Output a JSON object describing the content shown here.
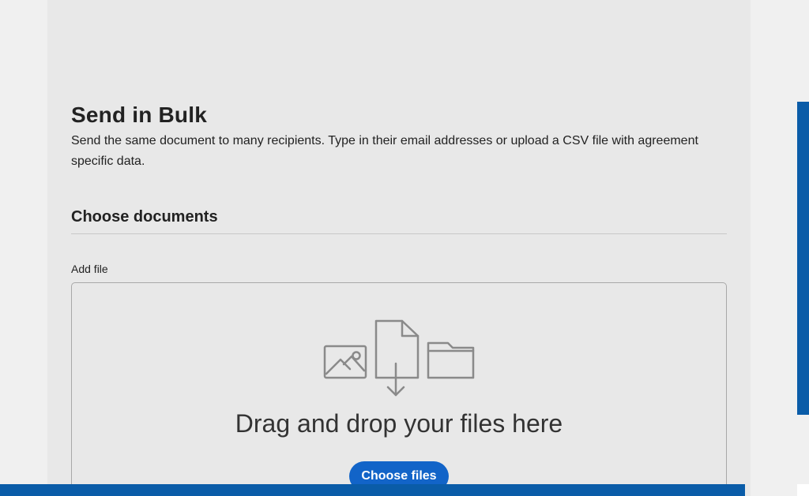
{
  "page": {
    "title": "Send in Bulk",
    "description": "Send the same document to many recipients. Type in their email addresses or upload a CSV file with agreement specific data."
  },
  "documents": {
    "section_heading": "Choose documents",
    "add_file_label": "Add file",
    "dropzone_text": "Drag and drop your files here",
    "choose_button_label": "Choose files",
    "icons": [
      "image-file-icon",
      "document-download-icon",
      "folder-icon"
    ]
  },
  "colors": {
    "accent_blue": "#0a5ca8",
    "button_blue": "#1264c8",
    "panel_background": "#e8e8e8"
  }
}
